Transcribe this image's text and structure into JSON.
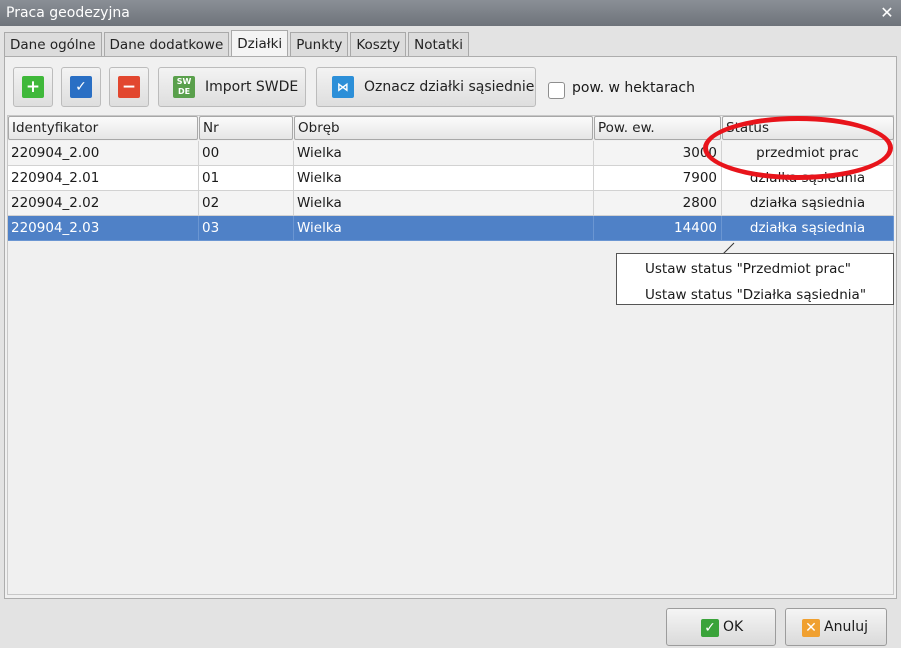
{
  "window": {
    "title": "Praca geodezyjna"
  },
  "tabs": [
    {
      "label": "Dane ogólne"
    },
    {
      "label": "Dane dodatkowe"
    },
    {
      "label": "Działki"
    },
    {
      "label": "Punkty"
    },
    {
      "label": "Koszty"
    },
    {
      "label": "Notatki"
    }
  ],
  "toolbar": {
    "import_label": "Import SWDE",
    "import_icon_text": "SW DE",
    "mark_neighbors_label": "Oznacz działki sąsiednie",
    "hectares_label": "pow. w hektarach",
    "hectares_checked": false
  },
  "table": {
    "columns": [
      "Identyfikator",
      "Nr",
      "Obręb",
      "Pow. ew.",
      "Status"
    ],
    "rows": [
      {
        "id": "220904_2.00",
        "nr": "00",
        "obreb": "Wielka",
        "pow": "3000",
        "status": "przedmiot prac"
      },
      {
        "id": "220904_2.01",
        "nr": "01",
        "obreb": "Wielka",
        "pow": "7900",
        "status": "działka sąsiednia"
      },
      {
        "id": "220904_2.02",
        "nr": "02",
        "obreb": "Wielka",
        "pow": "2800",
        "status": "działka sąsiednia"
      },
      {
        "id": "220904_2.03",
        "nr": "03",
        "obreb": "Wielka",
        "pow": "14400",
        "status": "działka sąsiednia"
      }
    ]
  },
  "context_menu": {
    "items": [
      {
        "label": "Ustaw status \"Przedmiot prac\""
      },
      {
        "label": "Ustaw status \"Działka sąsiednia\""
      }
    ]
  },
  "footer": {
    "ok_label": "OK",
    "cancel_label": "Anuluj"
  },
  "colors": {
    "selected_row": "#4f81c7",
    "annotation": "#e8141b",
    "add": "#3fb83a",
    "remove": "#e2472f",
    "confirm": "#2a6fc4"
  }
}
